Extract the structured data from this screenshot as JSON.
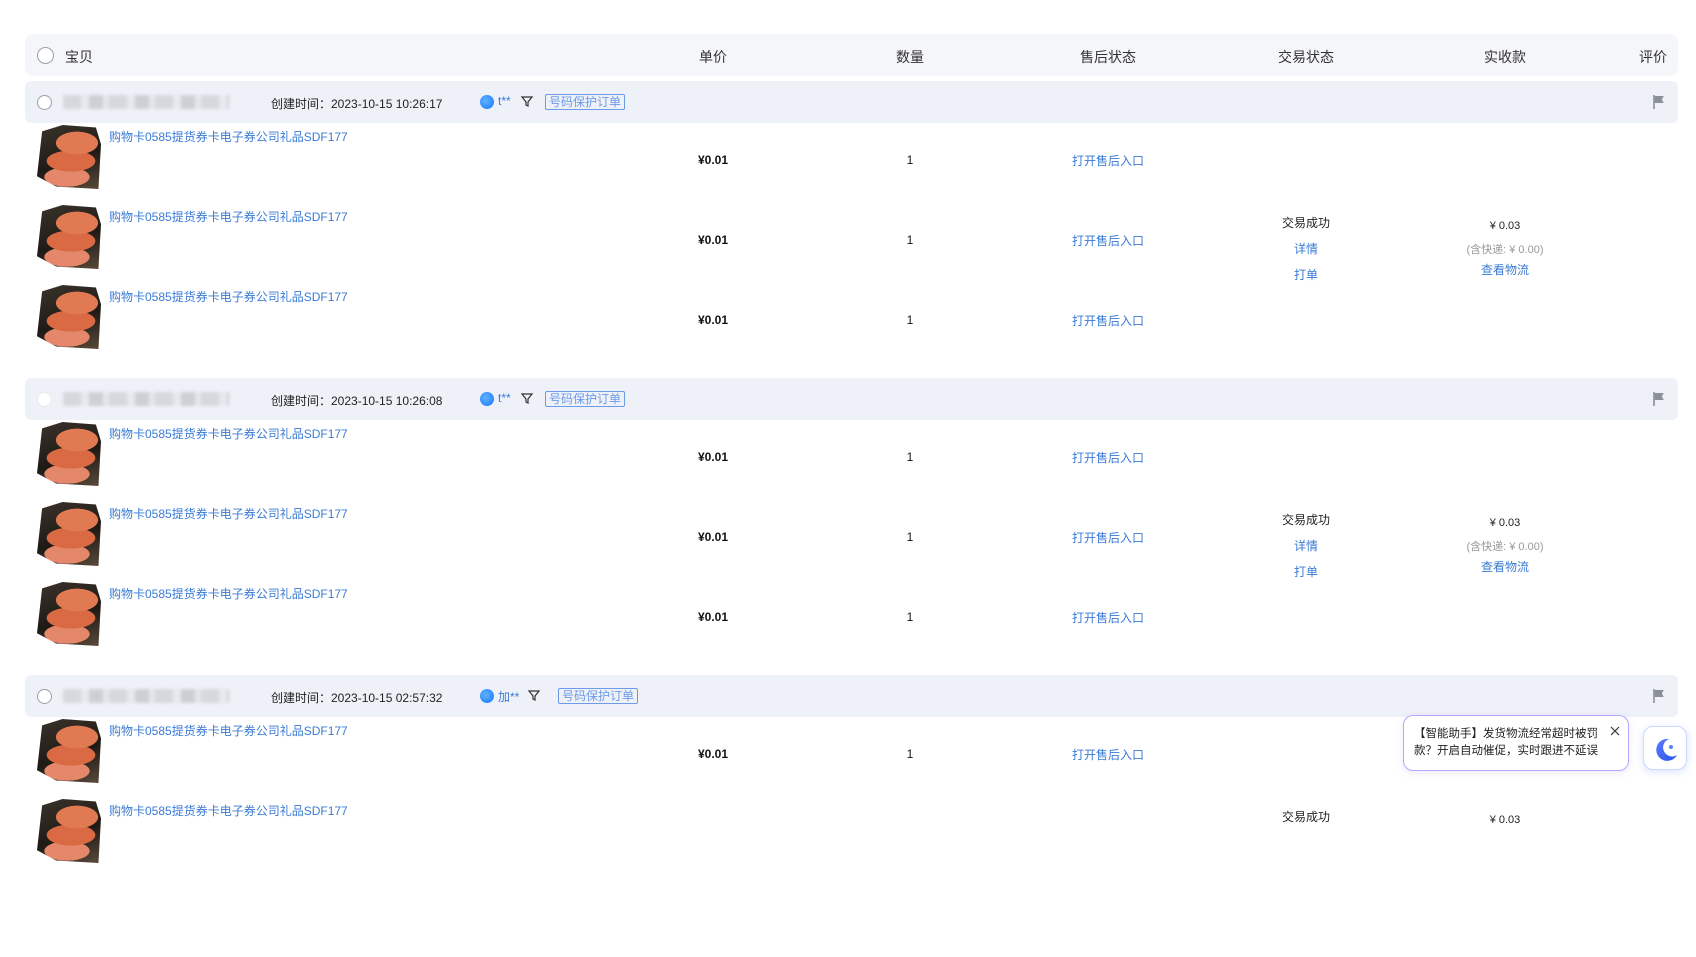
{
  "header": {
    "item": "宝贝",
    "price": "单价",
    "quantity": "数量",
    "after_sale_status": "售后状态",
    "trade_status": "交易状态",
    "paid": "实收款",
    "review": "评价"
  },
  "orders": [
    {
      "created": "创建时间：2023-10-15 10:26:17",
      "buyer": "t**",
      "tag": "号码保护订单",
      "items": [
        {
          "title": "购物卡0585提货券卡电子券公司礼品SDF177",
          "price": "¥0.01",
          "qty": "1",
          "after_sale": "打开售后入口"
        },
        {
          "title": "购物卡0585提货券卡电子券公司礼品SDF177",
          "price": "¥0.01",
          "qty": "1",
          "after_sale": "打开售后入口"
        },
        {
          "title": "购物卡0585提货券卡电子券公司礼品SDF177",
          "price": "¥0.01",
          "qty": "1",
          "after_sale": "打开售后入口"
        }
      ],
      "trade_status": "交易成功",
      "detail": "详情",
      "print": "打单",
      "paid": "¥ 0.03",
      "shipping": "(含快递: ¥ 0.00)",
      "logistics": "查看物流"
    },
    {
      "created": "创建时间：2023-10-15 10:26:08",
      "buyer": "t**",
      "tag": "号码保护订单",
      "items": [
        {
          "title": "购物卡0585提货券卡电子券公司礼品SDF177",
          "price": "¥0.01",
          "qty": "1",
          "after_sale": "打开售后入口"
        },
        {
          "title": "购物卡0585提货券卡电子券公司礼品SDF177",
          "price": "¥0.01",
          "qty": "1",
          "after_sale": "打开售后入口"
        },
        {
          "title": "购物卡0585提货券卡电子券公司礼品SDF177",
          "price": "¥0.01",
          "qty": "1",
          "after_sale": "打开售后入口"
        }
      ],
      "trade_status": "交易成功",
      "detail": "详情",
      "print": "打单",
      "paid": "¥ 0.03",
      "shipping": "(含快递: ¥ 0.00)",
      "logistics": "查看物流"
    },
    {
      "created": "创建时间：2023-10-15 02:57:32",
      "buyer": "加**",
      "tag": "号码保护订单",
      "items": [
        {
          "title": "购物卡0585提货券卡电子券公司礼品SDF177",
          "price": "¥0.01",
          "qty": "1",
          "after_sale": "打开售后入口"
        },
        {
          "title": "购物卡0585提货券卡电子券公司礼品SDF177"
        }
      ],
      "trade_status": "交易成功",
      "paid": "¥ 0.03"
    }
  ],
  "assistant": {
    "message": "【智能助手】发货物流经常超时被罚款？开启自动催促，实时跟进不延误"
  },
  "icons": {
    "buyer": "wangwang-icon",
    "filter": "filter-icon",
    "flag": "flag-icon",
    "close": "close-icon",
    "assistant": "assistant-icon"
  }
}
